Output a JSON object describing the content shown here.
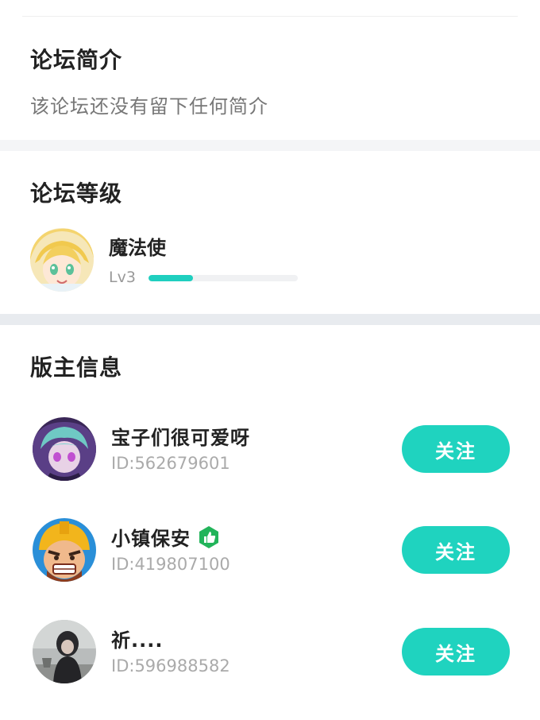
{
  "intro": {
    "title": "论坛简介",
    "text": "该论坛还没有留下任何简介"
  },
  "level": {
    "title": "论坛等级",
    "name": "魔法使",
    "lv": "Lv3",
    "progress": 0.3
  },
  "moderators": {
    "title": "版主信息",
    "items": [
      {
        "name": "宝子们很可爱呀",
        "id": "ID:562679601",
        "follow_label": "关注",
        "verified": false
      },
      {
        "name": "小镇保安",
        "id": "ID:419807100",
        "follow_label": "关注",
        "verified": true
      },
      {
        "name": "祈....",
        "id": "ID:596988582",
        "follow_label": "关注",
        "verified": false
      }
    ]
  },
  "colors": {
    "accent": "#1fd3bf",
    "verified_badge": "#22b45a"
  }
}
